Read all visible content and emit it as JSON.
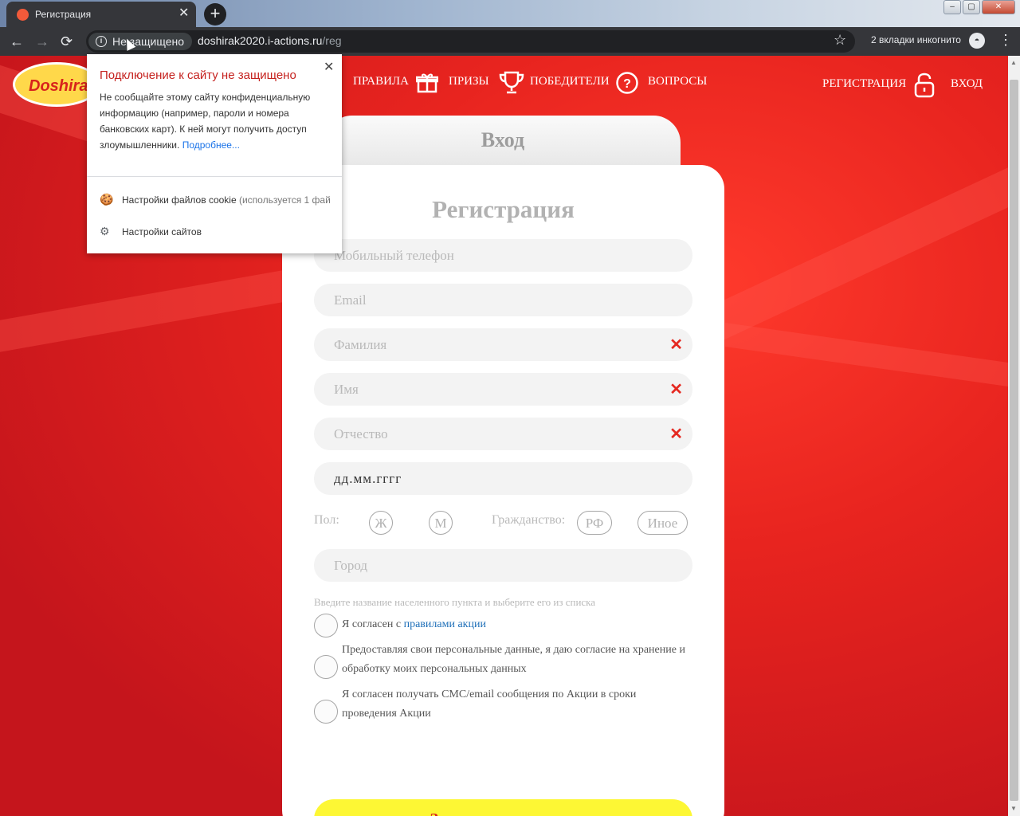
{
  "browser": {
    "tab_title": "Регистрация",
    "tab_close": "✕",
    "new_tab": "+",
    "security_chip": "Не защищено",
    "url_host": "doshirak2020.i-actions.ru",
    "url_path": "/reg",
    "incognito_text": "2 вкладки инкогнито",
    "back": "←",
    "forward": "→",
    "reload": "⟳",
    "star": "☆",
    "menu": "⋮",
    "win_minimize": "–",
    "win_maximize": "▢",
    "win_close": "✕"
  },
  "popup": {
    "title": "Подключение к сайту не защищено",
    "close": "✕",
    "body": "Не сообщайте этому сайту конфиденциальную информацию (например, пароли и номера банковских карт). К ней могут получить доступ злоумышленники.",
    "more_link": "Подробнее...",
    "cookie_label": "Настройки файлов cookie",
    "cookie_note": "(используется 1 фай...",
    "site_settings": "Настройки сайтов"
  },
  "site": {
    "logo": "Doshirak",
    "nav": {
      "rules": "ПРАВИЛА",
      "prizes": "ПРИЗЫ",
      "winners": "ПОБЕДИТЕЛИ",
      "faq": "ВОПРОСЫ",
      "register": "РЕГИСТРАЦИЯ",
      "login": "ВХОД"
    },
    "login_tab": "Вход",
    "form": {
      "title": "Регистрация",
      "phone_ph": "Мобильный телефон",
      "email_ph": "Email",
      "surname_ph": "Фамилия",
      "name_ph": "Имя",
      "patronymic_ph": "Отчество",
      "date_ph": "дд.мм.гггг",
      "clear_mark": "✕",
      "gender_label": "Пол:",
      "gender_f": "Ж",
      "gender_m": "М",
      "citizenship_label": "Гражданство:",
      "citizen_rf": "РФ",
      "citizen_other": "Иное",
      "city_ph": "Город",
      "city_hint": "Введите название населенного пункта и выберите его из списка",
      "agree_rules_prefix": "Я согласен с ",
      "agree_rules_link": "правилами акции",
      "agree_personal": "Предоставляя свои персональные данные, я даю согласие на хранение и обработку моих персональных данных",
      "agree_sms": "Я согласен получать СМС/email сообщения по Акции в сроки проведения Акции",
      "submit": "Зарегистрироваться"
    }
  },
  "colors": {
    "brand_red": "#e8241f",
    "submit_yellow": "#fdf734",
    "warning_red": "#c5221f"
  }
}
